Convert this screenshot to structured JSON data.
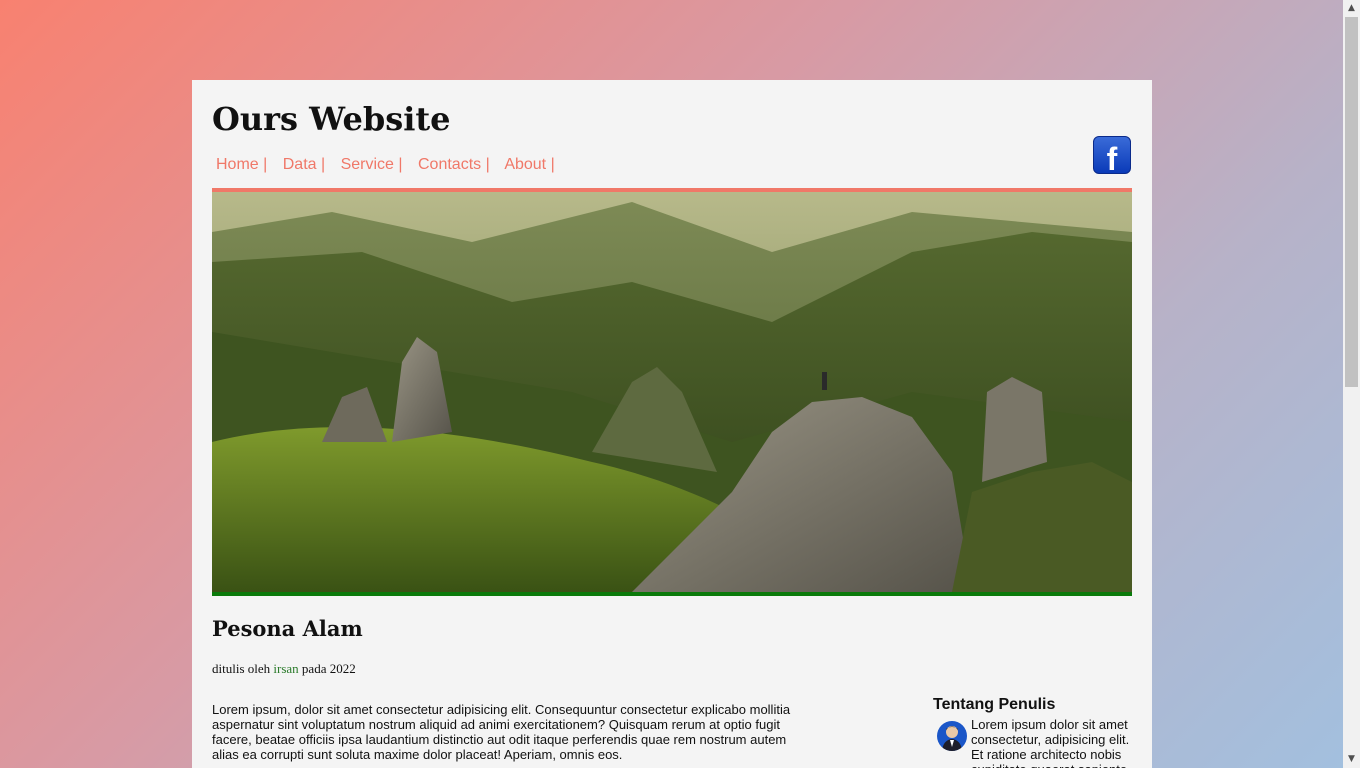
{
  "header": {
    "title": "Ours Website",
    "nav": [
      "Home |",
      "Data |",
      "Service |",
      "Contacts |",
      "About |"
    ],
    "social": {
      "label": "f",
      "icon": "facebook-icon",
      "color": "#1a4fcf"
    }
  },
  "banner": {
    "border_top": "#f07868",
    "border_bottom": "#0a7a0a"
  },
  "article": {
    "title": "Pesona Alam",
    "byline_prefix": "ditulis oleh",
    "byline_author": "irsan",
    "byline_suffix": "pada 2022",
    "body": "Lorem ipsum, dolor sit amet consectetur adipisicing elit. Consequuntur consectetur explicabo mollitia aspernatur sint voluptatum nostrum aliquid ad animi exercitationem? Quisquam rerum at optio fugit facere, beatae officiis ipsa laudantium distinctio aut odit itaque perferendis quae rem nostrum autem alias ea corrupti sunt soluta maxime dolor placeat! Aperiam, omnis eos."
  },
  "aside": {
    "title": "Tentang Penulis",
    "text": "Lorem ipsum dolor sit amet consectetur, adipisicing elit. Et ratione architecto nobis cupiditate quaerat sapiente rerum"
  },
  "colors": {
    "link": "#f07868",
    "author": "#2a7a2a",
    "panel": "#f4f4f4"
  }
}
